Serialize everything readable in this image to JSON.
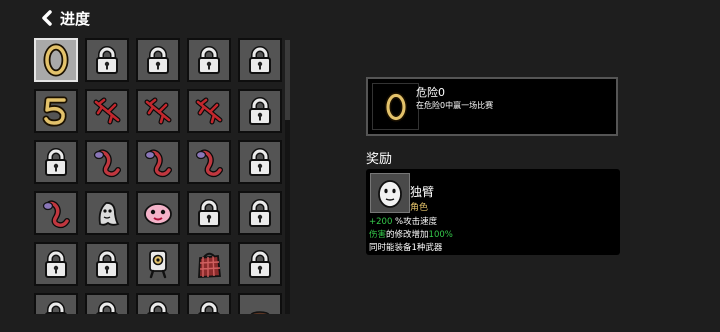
{
  "header": {
    "title": "进度"
  },
  "grid": {
    "cells": [
      {
        "icon": "egg-zero-icon",
        "selected": true
      },
      {
        "icon": "lock-icon"
      },
      {
        "icon": "lock-icon"
      },
      {
        "icon": "lock-icon"
      },
      {
        "icon": "lock-icon"
      },
      {
        "icon": "number-five-icon"
      },
      {
        "icon": "red-branch-icon"
      },
      {
        "icon": "red-branch-icon"
      },
      {
        "icon": "red-branch-icon"
      },
      {
        "icon": "lock-icon"
      },
      {
        "icon": "lock-icon"
      },
      {
        "icon": "purple-worm-icon"
      },
      {
        "icon": "purple-worm-icon"
      },
      {
        "icon": "purple-worm-icon"
      },
      {
        "icon": "lock-icon"
      },
      {
        "icon": "purple-worm-icon"
      },
      {
        "icon": "ghost-creature-icon"
      },
      {
        "icon": "pink-blob-icon"
      },
      {
        "icon": "lock-icon"
      },
      {
        "icon": "lock-icon"
      },
      {
        "icon": "lock-icon"
      },
      {
        "icon": "lock-icon"
      },
      {
        "icon": "robot-eye-icon"
      },
      {
        "icon": "plaid-bag-icon"
      },
      {
        "icon": "lock-icon"
      },
      {
        "icon": "lock-icon"
      },
      {
        "icon": "lock-icon"
      },
      {
        "icon": "lock-icon"
      },
      {
        "icon": "lock-icon"
      },
      {
        "icon": "brown-pot-icon"
      }
    ]
  },
  "detail": {
    "icon": "egg-zero-icon",
    "name": "危险0",
    "description": "在危险0中赢一场比赛"
  },
  "reward": {
    "label": "奖励",
    "portrait_icon": "potato-face-icon",
    "character_name": "独臂",
    "character_type": "角色",
    "stat1_value": "+200",
    "stat1_text": " %攻击速度",
    "stat2_prefix": "伤害",
    "stat2_middle": "的修改增加",
    "stat2_value": "100%",
    "stat3_text": "同时能装备1种武器"
  },
  "colors": {
    "selected_cell": "#a9a9a9",
    "cell": "#545454",
    "positive": "#34c94a",
    "gold": "#e3c26b",
    "lock": "#ebebeb"
  }
}
